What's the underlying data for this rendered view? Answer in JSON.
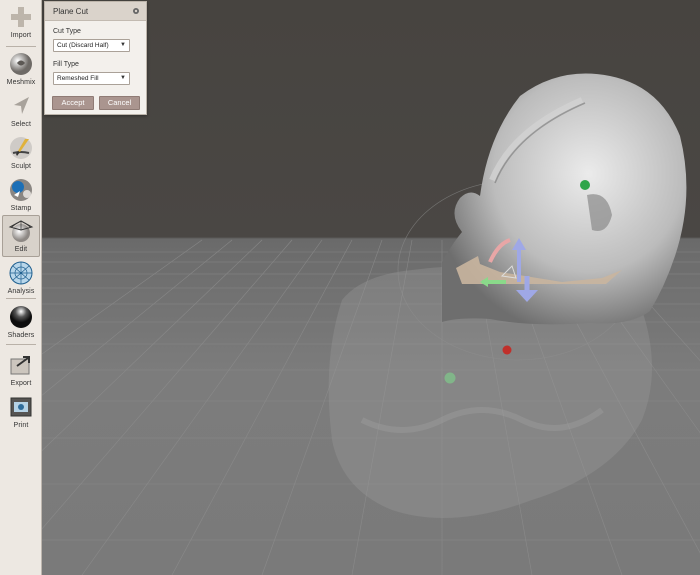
{
  "toolbar": {
    "items": [
      {
        "label": "Import",
        "icon": "plus-icon"
      },
      {
        "label": "Meshmix",
        "icon": "meshmix-sphere-icon"
      },
      {
        "label": "Select",
        "icon": "select-arrow-icon"
      },
      {
        "label": "Sculpt",
        "icon": "sculpt-brush-icon"
      },
      {
        "label": "Stamp",
        "icon": "stamp-icon"
      },
      {
        "label": "Edit",
        "icon": "edit-mesh-icon"
      },
      {
        "label": "Analysis",
        "icon": "analysis-sphere-icon"
      },
      {
        "label": "Shaders",
        "icon": "shader-sphere-icon"
      },
      {
        "label": "Export",
        "icon": "export-icon"
      },
      {
        "label": "Print",
        "icon": "print-icon"
      }
    ],
    "active": "Edit"
  },
  "panel": {
    "title": "Plane Cut",
    "cut_type_label": "Cut Type",
    "cut_type_value": "Cut (Discard Half)",
    "fill_type_label": "Fill Type",
    "fill_type_value": "Remeshed Fill",
    "accept_label": "Accept",
    "cancel_label": "Cancel"
  },
  "colors": {
    "toolbar_bg": "#ede8e2",
    "panel_bg": "#f3f0ec",
    "button": "#aa958f",
    "sky": "#474440",
    "floor": "#7c7c7c"
  }
}
